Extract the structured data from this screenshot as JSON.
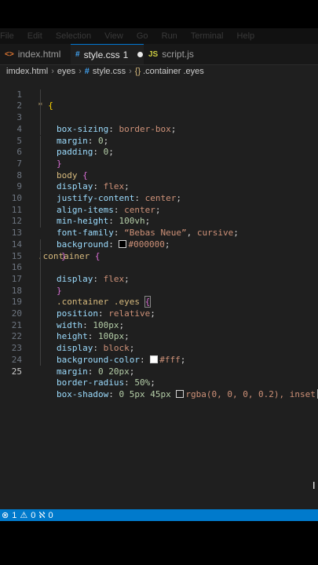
{
  "menubar": {
    "items": [
      "File",
      "Edit",
      "Selection",
      "View",
      "Go",
      "Run",
      "Terminal",
      "Help"
    ]
  },
  "tabs": [
    {
      "icon": "<>",
      "label": "index.html"
    },
    {
      "icon": "#",
      "label": "style.css",
      "badge": "1"
    },
    {
      "icon": "JS",
      "label": "script.js"
    }
  ],
  "breadcrumb": {
    "items": [
      "imdex.html",
      "eyes",
      "style.css",
      ".container .eyes"
    ],
    "icons": [
      "#",
      "{}"
    ]
  },
  "colors": {
    "accent": "#007acc",
    "editor_bg": "#1f1f1f"
  },
  "editor": {
    "lines": [
      {
        "n": "1"
      },
      {
        "n": "2"
      },
      {
        "n": "3"
      },
      {
        "n": "4"
      },
      {
        "n": "5"
      },
      {
        "n": "6"
      },
      {
        "n": "7"
      },
      {
        "n": "8"
      },
      {
        "n": "9"
      },
      {
        "n": "10"
      },
      {
        "n": "11"
      },
      {
        "n": "12"
      },
      {
        "n": "13"
      },
      {
        "n": "14"
      },
      {
        "n": "15"
      },
      {
        "n": "16"
      },
      {
        "n": "17"
      },
      {
        "n": "18"
      },
      {
        "n": "19"
      },
      {
        "n": "20"
      },
      {
        "n": "21"
      },
      {
        "n": "22"
      },
      {
        "n": "23"
      },
      {
        "n": "24"
      },
      {
        "n": "25"
      }
    ],
    "code": {
      "l1_sel": "*",
      "l1_brace": "{",
      "l2_prop": "box-sizing",
      "l2_val": "border-box",
      "l3_prop": "margin",
      "l3_val": "0",
      "l4_prop": "padding",
      "l4_val": "0",
      "l5_brace": "}",
      "l6_sel": "body",
      "l6_brace": "{",
      "l7_prop": "display",
      "l7_val": "flex",
      "l8_prop": "justify-content",
      "l8_val": "center",
      "l9_prop": "align-items",
      "l9_val": "center",
      "l10_prop": "min-height",
      "l10_val": "100vh",
      "l11_prop": "font-family",
      "l11_val": "“Bebas Neue”",
      "l11_val2": "cursive",
      "l12_prop": "background",
      "l12_val": "#000000",
      "l13_brace": "}",
      "l14_sel": ".container",
      "l14_brace": "{",
      "l15_prop": "display",
      "l15_val": "flex",
      "l16_brace": "}",
      "l17_sel": ".container .eyes",
      "l17_brace": "{",
      "l18_prop": "position",
      "l18_val": "relative",
      "l19_prop": "width",
      "l19_val": "100px",
      "l20_prop": "height",
      "l20_val": "100px",
      "l21_prop": "display",
      "l21_val": "block",
      "l22_prop": "background-color",
      "l22_val": "#fff",
      "l23_prop": "margin",
      "l23_val": "0 20px",
      "l24_prop": "border-radius",
      "l24_val": "50%",
      "l25_prop": "box-shadow",
      "l25_val": "0 5px 45px",
      "l25_val2": "rgba(0, 0, 0, 0.2), inset"
    },
    "swatches": {
      "black": "#000000",
      "white": "#ffffff",
      "shadow": "rgba(0,0,0,0.2)"
    }
  },
  "statusbar": {
    "errors": "1",
    "warnings": "0",
    "ports": "0"
  }
}
